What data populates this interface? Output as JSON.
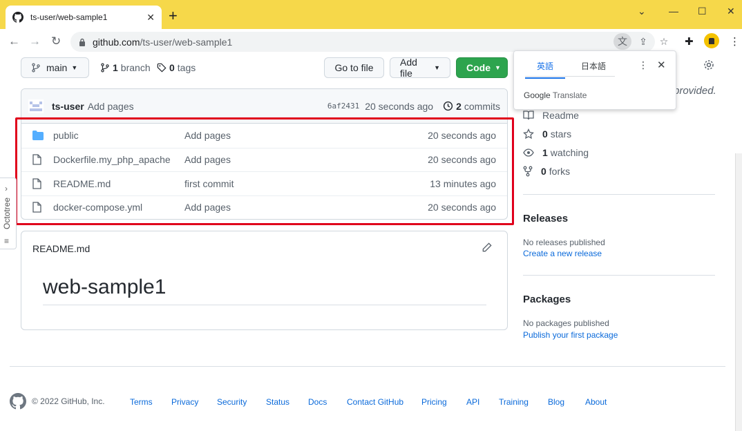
{
  "browser": {
    "tab_title": "ts-user/web-sample1",
    "url_host": "github.com",
    "url_path": "/ts-user/web-sample1"
  },
  "repo": {
    "branch_button": "main",
    "branches_count": "1",
    "branches_label": "branch",
    "tags_count": "0",
    "tags_label": "tags",
    "go_to_file": "Go to file",
    "add_file": "Add file",
    "code": "Code"
  },
  "latest_commit": {
    "author": "ts-user",
    "message": "Add pages",
    "sha": "6af2431",
    "time": "20 seconds ago",
    "commits_count": "2",
    "commits_label": "commits"
  },
  "files": [
    {
      "type": "folder",
      "name": "public",
      "message": "Add pages",
      "age": "20 seconds ago"
    },
    {
      "type": "file",
      "name": "Dockerfile.my_php_apache",
      "message": "Add pages",
      "age": "20 seconds ago"
    },
    {
      "type": "file",
      "name": "README.md",
      "message": "first commit",
      "age": "13 minutes ago"
    },
    {
      "type": "file",
      "name": "docker-compose.yml",
      "message": "Add pages",
      "age": "20 seconds ago"
    }
  ],
  "readme": {
    "filename": "README.md",
    "heading": "web-sample1"
  },
  "sidebar": {
    "provided_fragment": "provided.",
    "readme": "Readme",
    "stars_count": "0",
    "stars_label": "stars",
    "watching_count": "1",
    "watching_label": "watching",
    "forks_count": "0",
    "forks_label": "forks",
    "releases_title": "Releases",
    "releases_empty": "No releases published",
    "releases_link": "Create a new release",
    "packages_title": "Packages",
    "packages_empty": "No packages published",
    "packages_link": "Publish your first package"
  },
  "translate_popup": {
    "tab_source": "英語",
    "tab_target": "日本語",
    "brand_google": "Google",
    "brand_translate": "Translate"
  },
  "octotree": {
    "label": "Octotree"
  },
  "footer": {
    "copyright": "© 2022 GitHub, Inc.",
    "links": [
      "Terms",
      "Privacy",
      "Security",
      "Status",
      "Docs",
      "Contact GitHub",
      "Pricing",
      "API",
      "Training",
      "Blog",
      "About"
    ]
  },
  "colors": {
    "tab_strip": "#f6d84a",
    "code_button": "#2da44e",
    "highlight": "#e0001b",
    "link": "#0969da"
  }
}
